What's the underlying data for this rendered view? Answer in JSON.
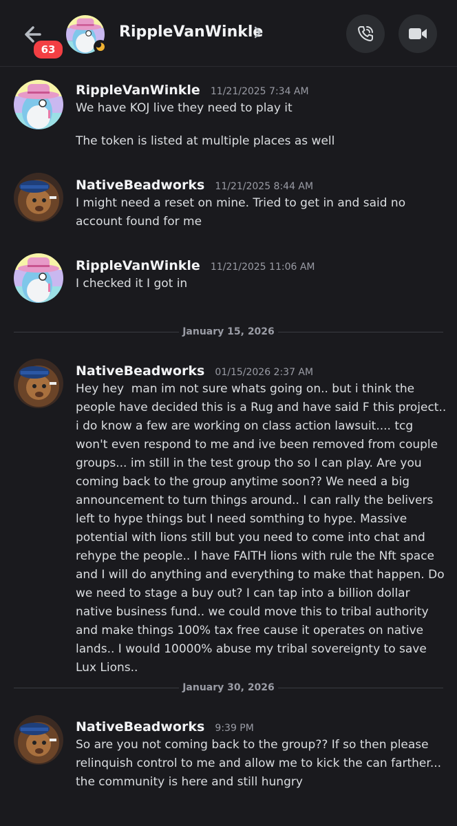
{
  "header": {
    "title": "RippleVanWinkle",
    "unread_count": "63"
  },
  "messages": [
    {
      "author": "RippleVanWinkle",
      "time": "11/21/2025 7:34 AM",
      "lines": [
        "We have KOJ live they need to play it",
        "The token is listed at multiple places as well"
      ]
    },
    {
      "author": "NativeBeadworks",
      "time": "11/21/2025 8:44 AM",
      "lines": [
        "I might need a reset on mine. Tried to get in and said no account found for me"
      ]
    },
    {
      "author": "RippleVanWinkle",
      "time": "11/21/2025 11:06 AM",
      "lines": [
        "I checked it I got in"
      ]
    },
    {
      "author": "NativeBeadworks",
      "time": "01/15/2026 2:37 AM",
      "lines": [
        "Hey hey  man im not sure whats going on.. but i think the people have decided this is a Rug and have said F this project.. i do know a few are working on class action lawsuit.... tcg won't even respond to me and ive been removed from couple groups... im still in the test group tho so I can play. Are you coming back to the group anytime soon?? We need a big announcement to turn things around.. I can rally the belivers left to hype things but I need somthing to hype. Massive potential with lions still but you need to come into chat and rehype the people.. I have FAITH lions with rule the Nft space and I will do anything and everything to make that happen. Do we need to stage a buy out? I can tap into a billion dollar native business fund.. we could move this to tribal authority and make things 100% tax free cause it operates on native lands.. I would 10000% abuse my tribal sovereignty to save Lux Lions.."
      ]
    },
    {
      "author": "NativeBeadworks",
      "time": "9:39 PM",
      "lines": [
        "So are you not coming back to the group?? If so then please relinquish control to me and allow me to kick the can farther... the community is here and still hungry"
      ]
    }
  ],
  "dividers": [
    "January 15, 2026",
    "January 30, 2026"
  ],
  "colors": {
    "background": "#1a1a1e",
    "badge": "#f23f43",
    "status_idle": "#f0b232"
  },
  "icons": [
    "back-arrow-icon",
    "chevron-right-icon",
    "phone-call-icon",
    "video-camera-icon",
    "moon-idle-icon"
  ]
}
